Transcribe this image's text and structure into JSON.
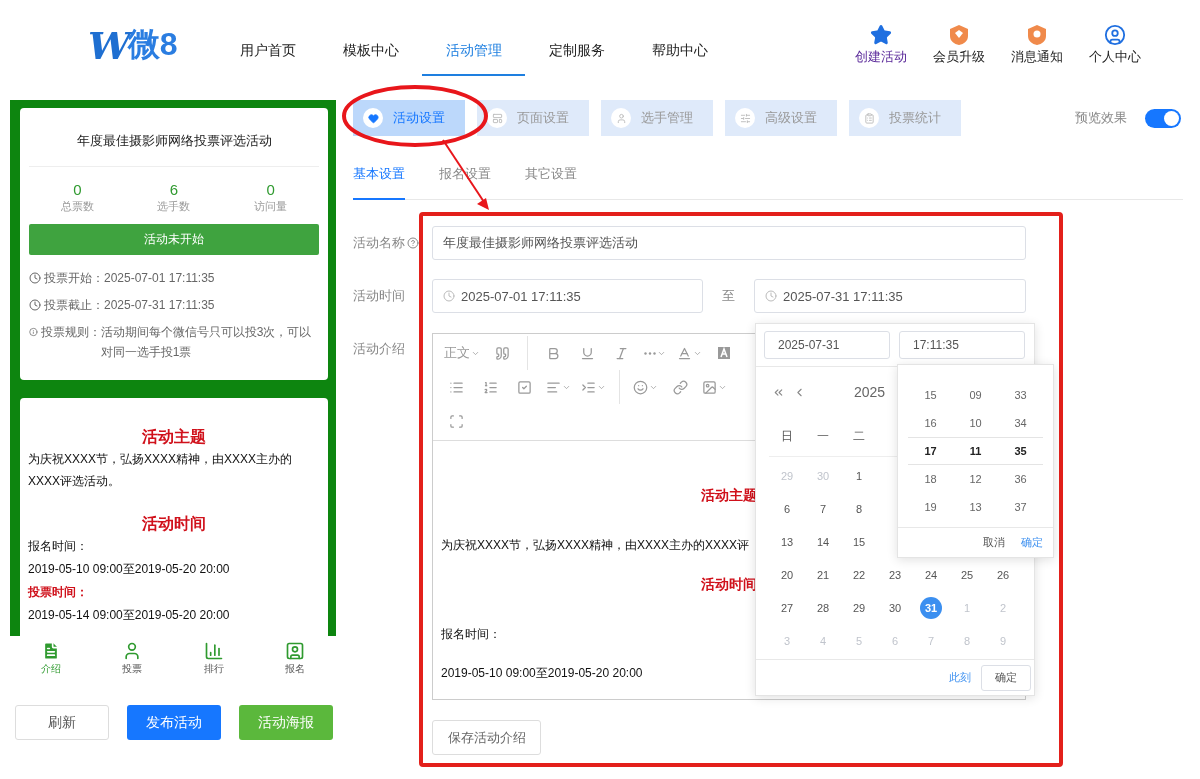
{
  "header": {
    "logo": {
      "mark": "W",
      "text": "微8"
    },
    "nav": [
      {
        "label": "用户首页",
        "selected": false
      },
      {
        "label": "模板中心",
        "selected": false
      },
      {
        "label": "活动管理",
        "selected": true
      },
      {
        "label": "定制服务",
        "selected": false
      },
      {
        "label": "帮助中心",
        "selected": false
      }
    ],
    "actions": [
      {
        "label": "创建活动",
        "kind": "create"
      },
      {
        "label": "会员升级",
        "kind": "upgrade"
      },
      {
        "label": "消息通知",
        "kind": "message"
      },
      {
        "label": "个人中心",
        "kind": "profile"
      }
    ]
  },
  "preview_panel": {
    "summary_card": {
      "title": "年度最佳摄影师网络投票评选活动",
      "stats": [
        {
          "value": "0",
          "label": "总票数"
        },
        {
          "value": "6",
          "label": "选手数"
        },
        {
          "value": "0",
          "label": "访问量"
        }
      ],
      "status": "活动未开始",
      "details": [
        {
          "kind": "clock",
          "label": "投票开始：",
          "value": "2025-07-01 17:11:35"
        },
        {
          "kind": "clock",
          "label": "投票截止：",
          "value": "2025-07-31 17:11:35"
        },
        {
          "kind": "info",
          "label": "投票规则：",
          "value": "活动期间每个微信号只可以投3次，可以对同一选手投1票"
        }
      ]
    },
    "intro_card": [
      {
        "kind": "heading",
        "text": "活动主题"
      },
      {
        "kind": "text",
        "text": "为庆祝XXXX节，弘扬XXXX精神，由XXXX主办的XXXX评选活动。"
      },
      {
        "kind": "heading",
        "text": "活动时间"
      },
      {
        "kind": "text",
        "text": "报名时间："
      },
      {
        "kind": "text",
        "text": "2019-05-10 09:00至2019-05-20 20:00"
      },
      {
        "kind": "highlight",
        "text": "投票时间："
      },
      {
        "kind": "text",
        "text": "2019-05-14 09:00至2019-05-20 20:00"
      }
    ],
    "bottom_nav": [
      {
        "label": "介绍",
        "kind": "intro",
        "selected": true
      },
      {
        "label": "投票",
        "kind": "vote",
        "selected": false
      },
      {
        "label": "排行",
        "kind": "rank",
        "selected": false
      },
      {
        "label": "报名",
        "kind": "signup",
        "selected": false
      }
    ],
    "buttons": [
      {
        "label": "刷新",
        "kind": "default"
      },
      {
        "label": "发布活动",
        "kind": "primary"
      },
      {
        "label": "活动海报",
        "kind": "success"
      }
    ]
  },
  "main_tabs": [
    {
      "label": "活动设置",
      "kind": "heart",
      "selected": true
    },
    {
      "label": "页面设置",
      "kind": "page",
      "selected": false
    },
    {
      "label": "选手管理",
      "kind": "user",
      "selected": false
    },
    {
      "label": "高级设置",
      "kind": "settings",
      "selected": false
    },
    {
      "label": "投票统计",
      "kind": "stats",
      "selected": false
    }
  ],
  "preview_toggle": {
    "label": "预览效果",
    "on": true
  },
  "sub_tabs": [
    {
      "label": "基本设置",
      "selected": true
    },
    {
      "label": "报名设置",
      "selected": false
    },
    {
      "label": "其它设置",
      "selected": false
    }
  ],
  "form": {
    "name": {
      "label": "活动名称",
      "value": "年度最佳摄影师网络投票评选活动"
    },
    "time": {
      "label": "活动时间",
      "start": "2025-07-01 17:11:35",
      "separator": "至",
      "end": "2025-07-31 17:11:35"
    },
    "intro": {
      "label": "活动介绍",
      "toolbar": [
        [
          {
            "kind": "text",
            "text": "正文",
            "caret": true
          },
          {
            "kind": "quote",
            "caret": false
          },
          {
            "kind": "divider"
          },
          {
            "kind": "bold",
            "caret": false
          },
          {
            "kind": "underline",
            "caret": false
          },
          {
            "kind": "italic",
            "caret": false
          },
          {
            "kind": "more",
            "caret": true
          },
          {
            "kind": "font-color",
            "caret": true
          },
          {
            "kind": "bg-color",
            "caret": false
          }
        ],
        [
          {
            "kind": "bullet-list",
            "caret": false
          },
          {
            "kind": "numbered-list",
            "caret": false
          },
          {
            "kind": "todo",
            "caret": false
          },
          {
            "kind": "align",
            "caret": true
          },
          {
            "kind": "indent",
            "caret": true
          },
          {
            "kind": "divider"
          },
          {
            "kind": "emoji",
            "caret": true
          },
          {
            "kind": "link",
            "caret": false
          },
          {
            "kind": "image",
            "caret": true
          }
        ],
        [
          {
            "kind": "fullscreen",
            "caret": false
          }
        ]
      ],
      "content": [
        {
          "kind": "heading",
          "text": "活动主题"
        },
        {
          "kind": "text",
          "text": "为庆祝XXXX节，弘扬XXXX精神，由XXXX主办的XXXX评"
        },
        {
          "kind": "heading",
          "text": "活动时间"
        },
        {
          "kind": "text",
          "text": "报名时间："
        },
        {
          "kind": "text",
          "text": "2019-05-10 09:00至2019-05-20 20:00"
        }
      ]
    },
    "save_button": "保存活动介绍"
  },
  "date_picker": {
    "date_input": "2025-07-31",
    "time_input": "17:11:35",
    "month_title": "2025",
    "weekdays": [
      "日",
      "一",
      "二"
    ],
    "weeks": [
      [
        {
          "day": "29",
          "muted": true,
          "selected": false
        },
        {
          "day": "30",
          "muted": true,
          "selected": false
        },
        {
          "day": "1",
          "muted": false,
          "selected": false
        }
      ],
      [
        {
          "day": "6",
          "muted": false,
          "selected": false
        },
        {
          "day": "7",
          "muted": false,
          "selected": false
        },
        {
          "day": "8",
          "muted": false,
          "selected": false
        }
      ],
      [
        {
          "day": "13",
          "muted": false,
          "selected": false
        },
        {
          "day": "14",
          "muted": false,
          "selected": false
        },
        {
          "day": "15",
          "muted": false,
          "selected": false
        }
      ],
      [
        {
          "day": "20",
          "muted": false,
          "selected": false
        },
        {
          "day": "21",
          "muted": false,
          "selected": false
        },
        {
          "day": "22",
          "muted": false,
          "selected": false
        },
        {
          "day": "23",
          "muted": false,
          "selected": false
        },
        {
          "day": "24",
          "muted": false,
          "selected": false
        },
        {
          "day": "25",
          "muted": false,
          "selected": false
        },
        {
          "day": "26",
          "muted": false,
          "selected": false
        }
      ],
      [
        {
          "day": "27",
          "muted": false,
          "selected": false
        },
        {
          "day": "28",
          "muted": false,
          "selected": false
        },
        {
          "day": "29",
          "muted": false,
          "selected": false
        },
        {
          "day": "30",
          "muted": false,
          "selected": false
        },
        {
          "day": "31",
          "muted": false,
          "selected": true
        },
        {
          "day": "1",
          "muted": true,
          "selected": false
        },
        {
          "day": "2",
          "muted": true,
          "selected": false
        }
      ],
      [
        {
          "day": "3",
          "muted": true,
          "selected": false
        },
        {
          "day": "4",
          "muted": true,
          "selected": false
        },
        {
          "day": "5",
          "muted": true,
          "selected": false
        },
        {
          "day": "6",
          "muted": true,
          "selected": false
        },
        {
          "day": "7",
          "muted": true,
          "selected": false
        },
        {
          "day": "8",
          "muted": true,
          "selected": false
        },
        {
          "day": "9",
          "muted": true,
          "selected": false
        }
      ]
    ],
    "now_link": "此刻",
    "confirm": "确定"
  },
  "time_panel": {
    "columns": [
      [
        {
          "value": "15",
          "selected": false
        },
        {
          "value": "16",
          "selected": false
        },
        {
          "value": "17",
          "selected": true
        },
        {
          "value": "18",
          "selected": false
        },
        {
          "value": "19",
          "selected": false
        }
      ],
      [
        {
          "value": "09",
          "selected": false
        },
        {
          "value": "10",
          "selected": false
        },
        {
          "value": "11",
          "selected": true
        },
        {
          "value": "12",
          "selected": false
        },
        {
          "value": "13",
          "selected": false
        }
      ],
      [
        {
          "value": "33",
          "selected": false
        },
        {
          "value": "34",
          "selected": false
        },
        {
          "value": "35",
          "selected": true
        },
        {
          "value": "36",
          "selected": false
        },
        {
          "value": "37",
          "selected": false
        }
      ]
    ],
    "cancel": "取消",
    "confirm": "确定"
  }
}
